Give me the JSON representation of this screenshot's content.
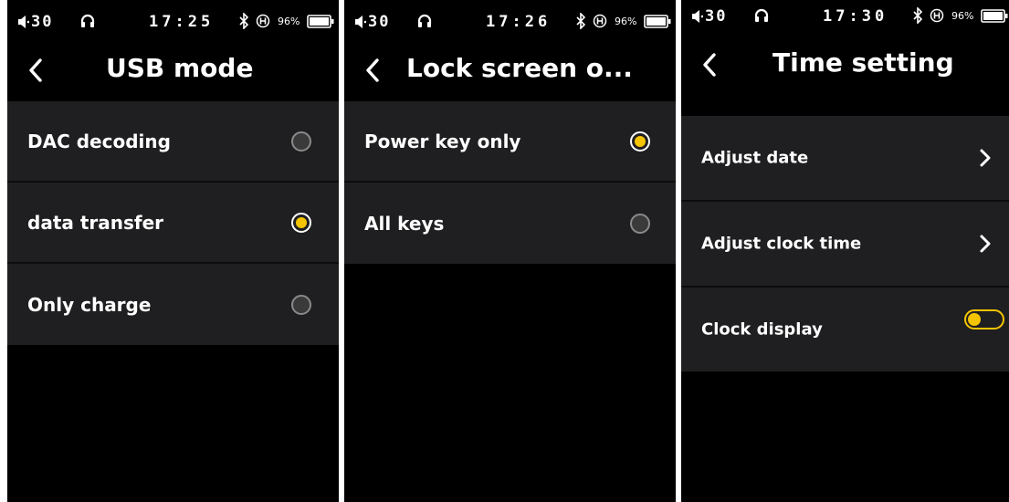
{
  "colors": {
    "accent": "#f5c400",
    "row_bg": "#1f1f21",
    "screen_bg": "#000000"
  },
  "screens": [
    {
      "status": {
        "volume": "30",
        "time": "17:25",
        "battery": "96%"
      },
      "title": "USB mode",
      "items": [
        {
          "label": "DAC decoding",
          "control": "radio",
          "selected": false
        },
        {
          "label": "data transfer",
          "control": "radio",
          "selected": true
        },
        {
          "label": "Only charge",
          "control": "radio",
          "selected": false
        }
      ]
    },
    {
      "status": {
        "volume": "30",
        "time": "17:26",
        "battery": "96%"
      },
      "title": "Lock screen o...",
      "items": [
        {
          "label": "Power key only",
          "control": "radio",
          "selected": true
        },
        {
          "label": "All keys",
          "control": "radio",
          "selected": false
        }
      ]
    },
    {
      "status": {
        "volume": "30",
        "time": "17:30",
        "battery": "96%"
      },
      "title": "Time setting",
      "items": [
        {
          "label": "Adjust date",
          "control": "chevron-right-icon"
        },
        {
          "label": "Adjust clock time",
          "control": "chevron-right-icon"
        },
        {
          "label": "Clock display",
          "control": "toggle",
          "on": true
        }
      ]
    }
  ]
}
